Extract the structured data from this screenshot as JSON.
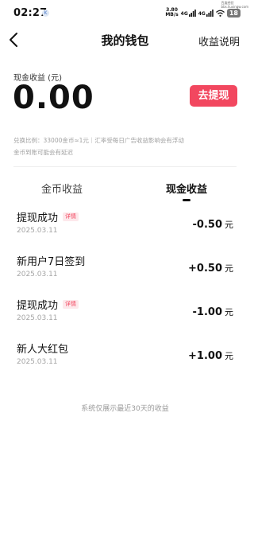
{
  "status_bar": {
    "time": "02:27",
    "notification_badge": "K",
    "net_speed_value": "3.80",
    "net_speed_unit": "MB/s",
    "signal_1_label": "4G",
    "signal_2_label": "4G",
    "battery": "18",
    "watermark_line1": "百度经验",
    "watermark_line2": "bbs.liuxingw.com"
  },
  "header": {
    "title": "我的钱包",
    "right_link": "收益说明"
  },
  "balance": {
    "label": "现金收益 (元)",
    "amount": "0.00",
    "withdraw_button": "去提现"
  },
  "notes": {
    "exchange_rate": "兑换比例：33000金币≈1元｜汇率受每日广告收益影响会有浮动",
    "arrival": "金币到账可能会有延迟"
  },
  "tabs": [
    {
      "label": "金币收益",
      "active": false
    },
    {
      "label": "现金收益",
      "active": true
    }
  ],
  "records": [
    {
      "title": "提现成功",
      "badge": "详情",
      "date": "2025.03.11",
      "amount": "-0.50",
      "unit": "元"
    },
    {
      "title": "新用户7日签到",
      "badge": "",
      "date": "2025.03.11",
      "amount": "+0.50",
      "unit": "元"
    },
    {
      "title": "提现成功",
      "badge": "详情",
      "date": "2025.03.11",
      "amount": "-1.00",
      "unit": "元"
    },
    {
      "title": "新人大红包",
      "badge": "",
      "date": "2025.03.11",
      "amount": "+1.00",
      "unit": "元"
    }
  ],
  "footer": "系统仅展示最近30天的收益",
  "colors": {
    "accent": "#f2475f",
    "muted_text": "#a0a0a0"
  }
}
